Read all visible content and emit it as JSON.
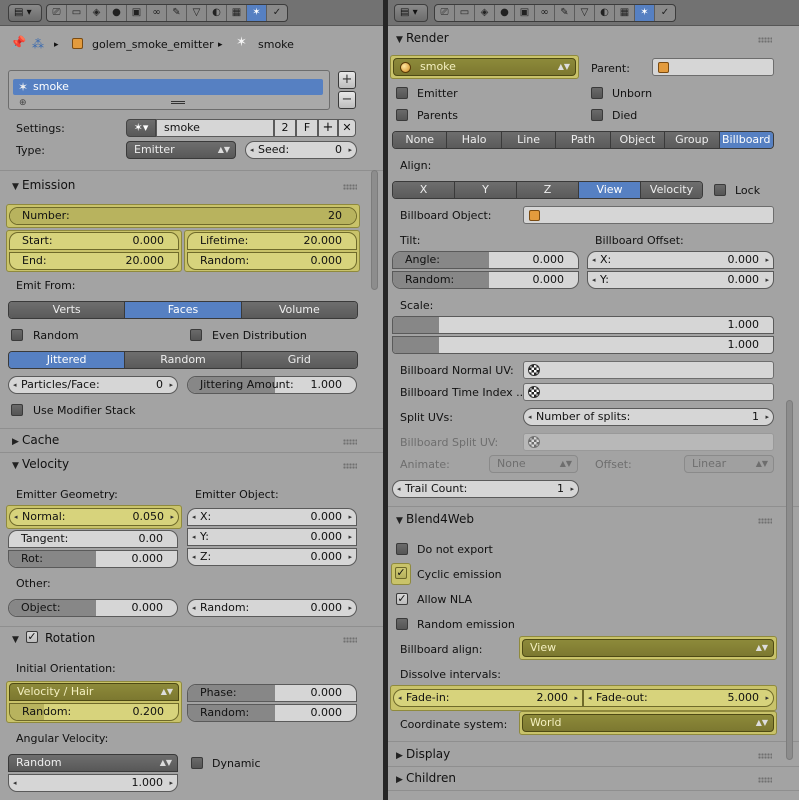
{
  "left": {
    "header_menu": "▤ ▾",
    "header_tab_icons": [
      "⎚",
      "▭",
      "◈",
      "●",
      "▣",
      "∞",
      "✎",
      "▽",
      "◐",
      "▦",
      "✶",
      "✓"
    ],
    "breadcrumb": {
      "object": "golem_smoke_emitter",
      "system": "smoke",
      "sep": "▸"
    },
    "particle_list": {
      "selected": "smoke",
      "add": "+",
      "remove": "−"
    },
    "settings": {
      "label": "Settings:",
      "value": "smoke",
      "users": "2",
      "fake": "F",
      "add": "+",
      "remove": "✕"
    },
    "type": {
      "label": "Type:",
      "value": "Emitter",
      "seed_label": "Seed:",
      "seed_value": "0"
    },
    "emission": {
      "title": "Emission",
      "number_label": "Number:",
      "number": "20",
      "start_label": "Start:",
      "start": "0.000",
      "end_label": "End:",
      "end": "20.000",
      "lifetime_label": "Lifetime:",
      "lifetime": "20.000",
      "random_label": "Random:",
      "random": "0.000",
      "emit_from": "Emit From:",
      "emit_tabs": [
        "Verts",
        "Faces",
        "Volume"
      ],
      "random_cb": "Random",
      "even_cb": "Even Distribution",
      "dist_tabs": [
        "Jittered",
        "Random",
        "Grid"
      ],
      "ppf_label": "Particles/Face:",
      "ppf": "0",
      "jitter_label": "Jittering Amount:",
      "jitter": "1.000",
      "modstack": "Use Modifier Stack"
    },
    "cache": {
      "title": "Cache"
    },
    "velocity": {
      "title": "Velocity",
      "geom_label": "Emitter Geometry:",
      "obj_label": "Emitter Object:",
      "normal_label": "Normal:",
      "normal": "0.050",
      "tangent_label": "Tangent:",
      "tangent": "0.00",
      "rot_label": "Rot:",
      "rot": "0.000",
      "x_label": "X:",
      "x": "0.000",
      "y_label": "Y:",
      "y": "0.000",
      "z_label": "Z:",
      "z": "0.000",
      "other": "Other:",
      "object_label": "Object:",
      "object": "0.000",
      "random_label": "Random:",
      "random": "0.000"
    },
    "rotation": {
      "title": "Rotation",
      "init_label": "Initial Orientation:",
      "mode": "Velocity / Hair",
      "random_label": "Random:",
      "random": "0.200",
      "phase_label": "Phase:",
      "phase": "0.000",
      "prand_label": "Random:",
      "prand": "0.000",
      "ang_label": "Angular Velocity:",
      "ang_mode": "Random",
      "ang_value": "1.000",
      "dynamic": "Dynamic"
    }
  },
  "right": {
    "header_menu": "▤ ▾",
    "header_tab_icons": [
      "⎚",
      "▭",
      "◈",
      "●",
      "▣",
      "∞",
      "✎",
      "▽",
      "◐",
      "▦",
      "✶",
      "✓"
    ],
    "render": {
      "title": "Render",
      "material": "smoke",
      "parent_label": "Parent:",
      "emitter": "Emitter",
      "unborn": "Unborn",
      "parents": "Parents",
      "died": "Died",
      "modes": [
        "None",
        "Halo",
        "Line",
        "Path",
        "Object",
        "Group",
        "Billboard"
      ],
      "align_label": "Align:",
      "align_tabs": [
        "X",
        "Y",
        "Z",
        "View",
        "Velocity"
      ],
      "lock": "Lock",
      "bb_object": "Billboard Object:",
      "tilt": "Tilt:",
      "offset": "Billboard Offset:",
      "angle_label": "Angle:",
      "angle": "0.000",
      "trand_label": "Random:",
      "trand": "0.000",
      "ox_label": "X:",
      "ox": "0.000",
      "oy_label": "Y:",
      "oy": "0.000",
      "scale": "Scale:",
      "scale1": "1.000",
      "scale2": "1.000",
      "normal_uv": "Billboard Normal UV:",
      "time_uv": "Billboard Time Index ...",
      "split_uvs": "Split UVs:",
      "splits_label": "Number of splits:",
      "splits": "1",
      "split_uv": "Billboard Split UV:",
      "animate": "Animate:",
      "animate_v": "None",
      "offset_label": "Offset:",
      "offset_v": "Linear",
      "trail_label": "Trail Count:",
      "trail": "1"
    },
    "b4w": {
      "title": "Blend4Web",
      "no_export": "Do not export",
      "cyclic": "Cyclic emission",
      "nla": "Allow NLA",
      "random_em": "Random emission",
      "bb_align_label": "Billboard align:",
      "bb_align": "View",
      "dissolve": "Dissolve intervals:",
      "fadein_label": "Fade-in:",
      "fadein": "2.000",
      "fadeout_label": "Fade-out:",
      "fadeout": "5.000",
      "coord_label": "Coordinate system:",
      "coord": "World"
    },
    "display": {
      "title": "Display"
    },
    "children": {
      "title": "Children"
    }
  },
  "colors": {
    "panel": "#a3a3a3",
    "selected": "#5680c2",
    "highlight": "#d7d37c",
    "highlight_dark": "#8d8a3a"
  }
}
